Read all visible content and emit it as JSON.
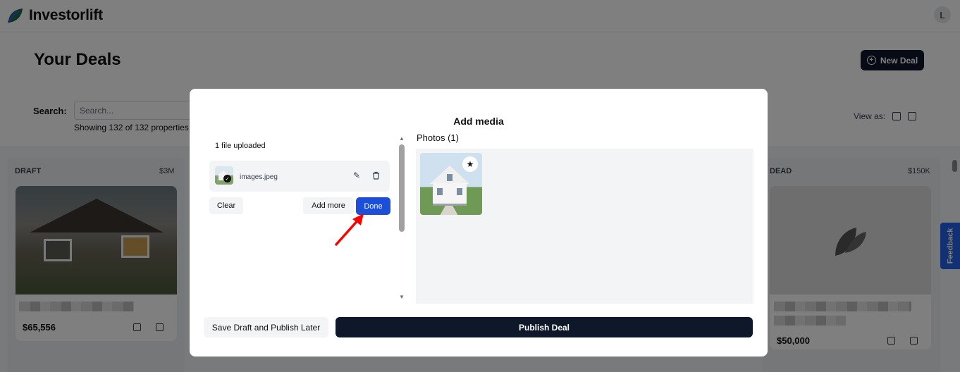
{
  "header": {
    "brand": "Investorlift",
    "avatar_letter": "L"
  },
  "page": {
    "title": "Your Deals",
    "new_deal_label": "New Deal"
  },
  "search": {
    "label": "Search:",
    "placeholder": "Search...",
    "showing": "Showing 132 of 132 properties.",
    "view_as": "View as:"
  },
  "columns": [
    {
      "title": "DRAFT",
      "amount": "$3M",
      "card_price": "$65,556"
    },
    {
      "title": "DEAD",
      "amount": "$150K",
      "card_price": "$50,000"
    }
  ],
  "feedback_label": "Feedback",
  "modal": {
    "title": "Add media",
    "uploaded_label": "1 file uploaded",
    "file_name": "images.jpeg",
    "clear_label": "Clear",
    "add_more_label": "Add more",
    "done_label": "Done",
    "photos_label": "Photos (1)",
    "save_draft_label": "Save Draft and Publish Later",
    "publish_label": "Publish Deal"
  },
  "colors": {
    "primary_dark": "#0f172a",
    "done_blue": "#1d4ed8",
    "feedback_blue": "#2563eb",
    "arrow_red": "#ff0000"
  }
}
